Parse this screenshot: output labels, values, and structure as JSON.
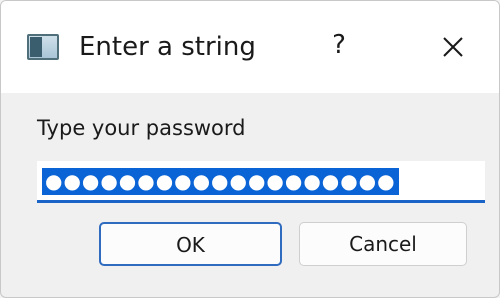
{
  "window": {
    "title": "Enter a string",
    "help_label": "?"
  },
  "dialog": {
    "prompt": "Type your password",
    "password_masked": "●●●●●●●●●●●●●●●●●●●",
    "ok_label": "OK",
    "cancel_label": "Cancel"
  },
  "icons": {
    "app": "app-window-icon",
    "close": "close-icon"
  },
  "colors": {
    "selection": "#0a64d6",
    "focus_border": "#1a63c7",
    "default_button_border": "#2f6bbf"
  }
}
